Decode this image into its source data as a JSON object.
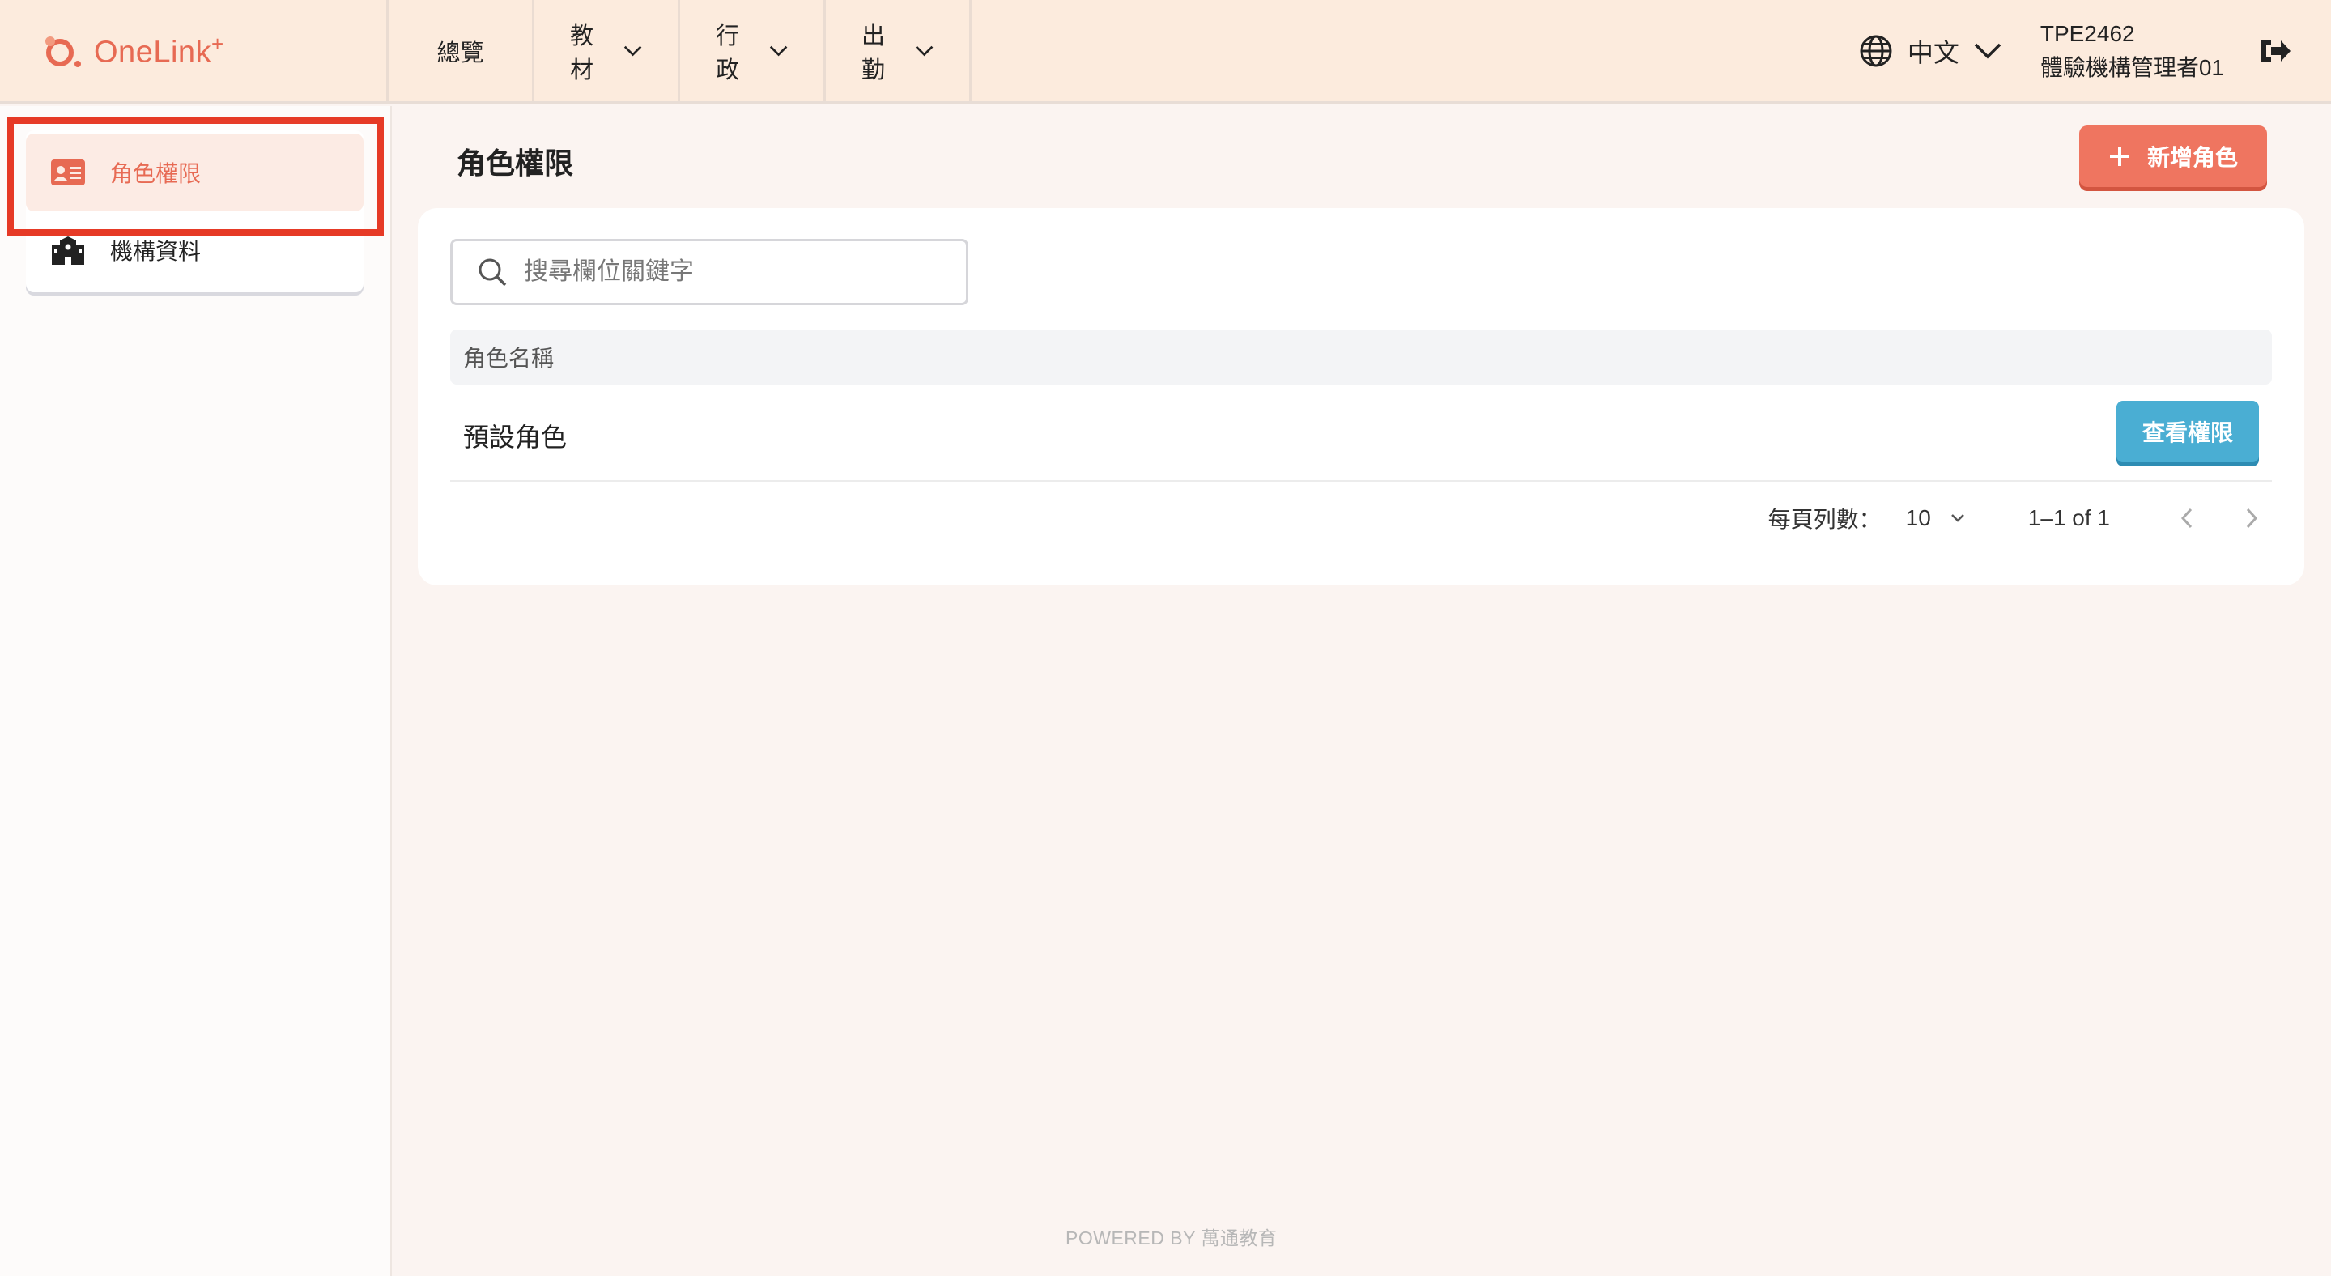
{
  "brand": {
    "name": "OneLink",
    "sup": "+"
  },
  "nav": {
    "overview": "總覽",
    "materials": "教材",
    "admin": "行政",
    "attendance": "出勤"
  },
  "header": {
    "language": "中文",
    "user_id": "TPE2462",
    "user_role": "體驗機構管理者01"
  },
  "sidebar": {
    "items": [
      {
        "label": "角色權限",
        "icon": "id-card-icon",
        "active": true
      },
      {
        "label": "機構資料",
        "icon": "building-icon",
        "active": false
      }
    ]
  },
  "main": {
    "title": "角色權限",
    "add_button": "新增角色",
    "search_placeholder": "搜尋欄位關鍵字",
    "table": {
      "columns": [
        "角色名稱"
      ],
      "rows": [
        {
          "name": "預設角色",
          "action": "查看權限"
        }
      ]
    },
    "pagination": {
      "rows_per_page_label": "每頁列數：",
      "rows_per_page": "10",
      "range": "1–1 of 1"
    }
  },
  "footer": "POWERED BY 萬通教育",
  "colors": {
    "accent": "#ef7560",
    "topbar": "#fcebdd",
    "view_button": "#4aaed3",
    "highlight": "#e63a26"
  }
}
